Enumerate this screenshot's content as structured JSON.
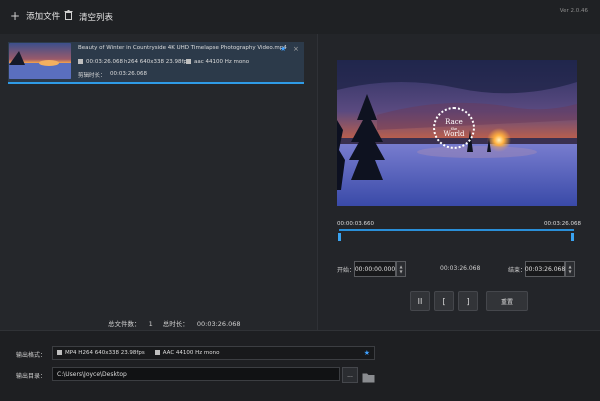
{
  "toolbar": {
    "add_files": "添加文件",
    "clear_list": "清空列表",
    "version": "Ver 2.0.46"
  },
  "file_list": [
    {
      "title": "Beauty of Winter in Countryside 4K UHD Timelapse Photography Video.mp4",
      "duration": "00:03:26.068",
      "video_info": "h264 640x338 23.98fps",
      "audio_info": "aac 44100 Hz mono",
      "clip_label": "剪辑时长：",
      "clip_duration": "00:03:26.068"
    }
  ],
  "totals": {
    "count_label": "总文件数：",
    "count": "1",
    "duration_label": "总时长：",
    "duration": "00:03:26.068"
  },
  "preview": {
    "logo_line1": "Race",
    "logo_line2": "the",
    "logo_line3": "World"
  },
  "timeline": {
    "start_time": "00:00:03.660",
    "end_time": "00:03:26.068",
    "start_label": "开始：",
    "start_value": "00:00:00.000",
    "mid_value": "00:03:26.068",
    "end_label": "结束：",
    "end_value": "00:03:26.068"
  },
  "controls": {
    "pause": "II",
    "mark_in": "[",
    "mark_out": "]",
    "reset": "重置"
  },
  "output": {
    "format_label": "输出格式：",
    "format_video": "MP4 H264 640x338 23.98fps",
    "format_audio": "AAC 44100 Hz mono",
    "dir_label": "输出目录：",
    "dir_value": "C:\\Users\\Joyce\\Desktop",
    "browse": "..."
  },
  "colors": {
    "accent": "#2f9be6",
    "background": "#202226"
  }
}
